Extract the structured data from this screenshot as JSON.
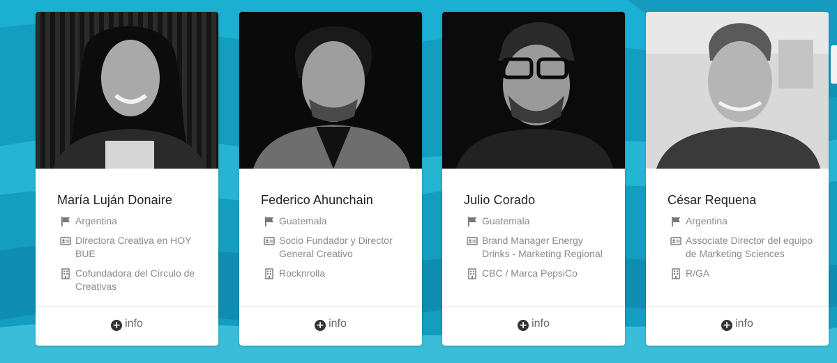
{
  "speakers": [
    {
      "name": "María Luján Donaire",
      "country": "Argentina",
      "role": "Directora Creativa en HOY BUE",
      "company": "Cofundadora del Círculo de Creativas",
      "info_label": "info",
      "photo_alt": "Foto de María Luján Donaire"
    },
    {
      "name": "Federico Ahunchain",
      "country": "Guatemala",
      "role": "Socio Fundador y Director General Creativo",
      "company": "Rocknrolla",
      "info_label": "info",
      "photo_alt": "Foto de Federico Ahunchain"
    },
    {
      "name": "Julio Corado",
      "country": "Guatemala",
      "role": "Brand Manager Energy Drinks - Marketing Regional",
      "company": "CBC / Marca PepsiCo",
      "info_label": "info",
      "photo_alt": "Foto de Julio Corado"
    },
    {
      "name": "César Requena",
      "country": "Argentina",
      "role": "Associate Director del equipo de Marketing Sciences",
      "company": "R/GA",
      "info_label": "info",
      "photo_alt": "Foto de César Requena"
    }
  ],
  "icons": {
    "country": "flag-icon",
    "role": "id-card-icon",
    "company": "building-icon",
    "info": "plus-circle-icon"
  },
  "colors": {
    "background": "#139dbf",
    "card": "#ffffff",
    "meta_text": "#8a8a8a",
    "name_text": "#222222"
  }
}
